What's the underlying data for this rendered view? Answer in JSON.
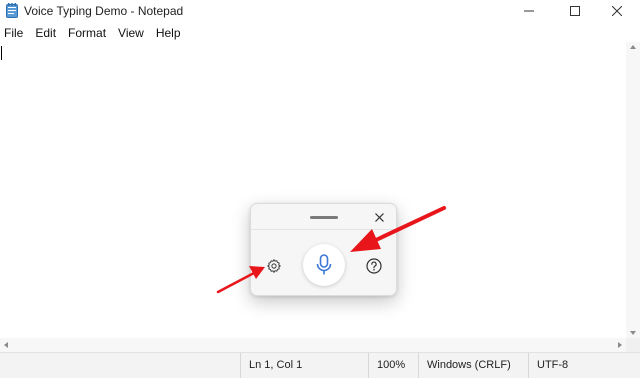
{
  "window": {
    "title": "Voice Typing Demo - Notepad",
    "icons": {
      "app": "notepad-icon",
      "minimize": "minimize-icon",
      "maximize": "maximize-icon",
      "close": "close-icon"
    }
  },
  "menu": {
    "items": [
      {
        "label": "File"
      },
      {
        "label": "Edit"
      },
      {
        "label": "Format"
      },
      {
        "label": "View"
      },
      {
        "label": "Help"
      }
    ]
  },
  "editor": {
    "content": ""
  },
  "status": {
    "position": "Ln 1, Col 1",
    "zoom": "100%",
    "line_ending": "Windows (CRLF)",
    "encoding": "UTF-8"
  },
  "voice_typing": {
    "icons": {
      "drag_handle": "drag-handle-icon",
      "close": "close-icon",
      "settings": "gear-icon",
      "microphone": "microphone-icon",
      "help": "help-icon"
    }
  },
  "colors": {
    "annotation_arrow": "#e8161b",
    "accent_icon": "#3c78d8",
    "status_bar": "#f3f3f3"
  }
}
